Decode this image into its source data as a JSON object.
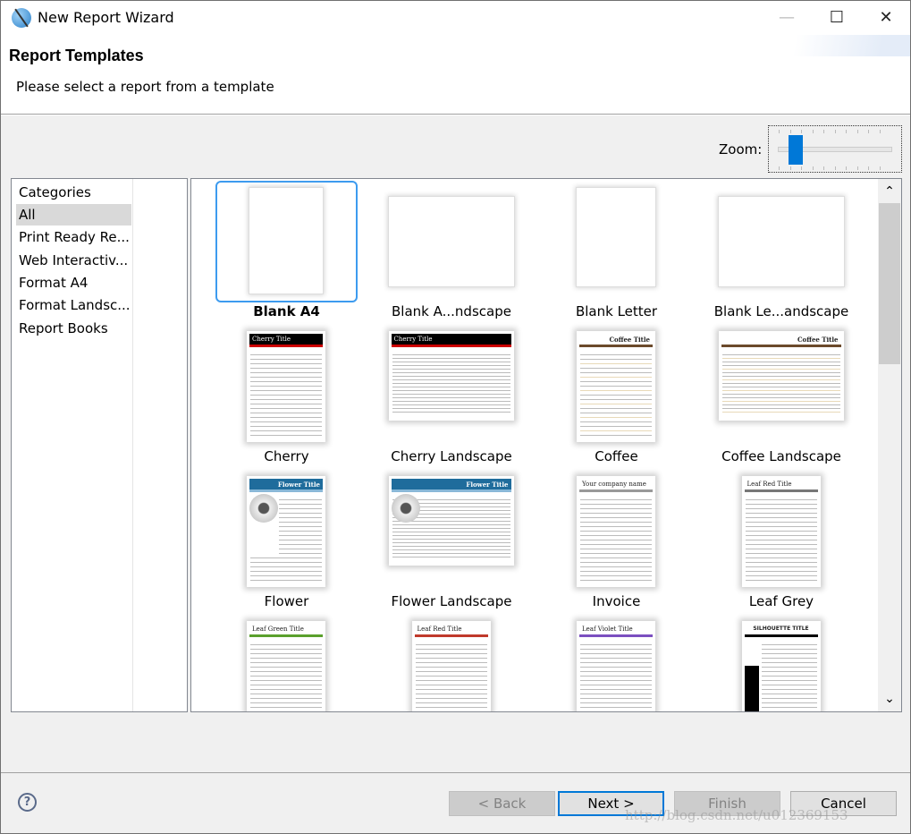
{
  "window": {
    "title": "New Report Wizard",
    "minimize": "—",
    "maximize": "☐",
    "close": "✕"
  },
  "header": {
    "title": "Report Templates",
    "subtitle": "Please select a report from a template"
  },
  "zoom": {
    "label": "Zoom:",
    "level_fraction": 0.12
  },
  "categories": {
    "header": "Categories",
    "items": [
      "All",
      "Print Ready Re...",
      "Web Interactiv...",
      "Format A4",
      "Format Landsc...",
      "Report Books"
    ],
    "selected": "All"
  },
  "templates": [
    {
      "label": "Blank A4",
      "style": "blank",
      "orient": "portrait",
      "selected": true
    },
    {
      "label": "Blank A...ndscape",
      "style": "blank",
      "orient": "landscape"
    },
    {
      "label": "Blank Letter",
      "style": "blank",
      "orient": "portrait"
    },
    {
      "label": "Blank Le...andscape",
      "style": "blank",
      "orient": "landscape"
    },
    {
      "label": "Cherry",
      "style": "cherry",
      "orient": "portrait",
      "thumb_title": "Cherry Title"
    },
    {
      "label": "Cherry Landscape",
      "style": "cherry",
      "orient": "landscape",
      "thumb_title": "Cherry Title"
    },
    {
      "label": "Coffee",
      "style": "coffee",
      "orient": "portrait",
      "thumb_title": "Coffee Title"
    },
    {
      "label": "Coffee Landscape",
      "style": "coffee",
      "orient": "landscape",
      "thumb_title": "Coffee Title"
    },
    {
      "label": "Flower",
      "style": "flower",
      "orient": "portrait",
      "thumb_title": "Flower Title"
    },
    {
      "label": "Flower Landscape",
      "style": "flower",
      "orient": "landscape",
      "thumb_title": "Flower Title"
    },
    {
      "label": "Invoice",
      "style": "invoice",
      "orient": "portrait",
      "thumb_title": "Your company name"
    },
    {
      "label": "Leaf Grey",
      "style": "leafgrey",
      "orient": "portrait",
      "thumb_title": "Leaf Red Title"
    },
    {
      "label": "",
      "style": "leafgreen",
      "orient": "portrait",
      "thumb_title": "Leaf Green Title"
    },
    {
      "label": "",
      "style": "leafred",
      "orient": "portrait",
      "thumb_title": "Leaf Red Title"
    },
    {
      "label": "",
      "style": "leafviolet",
      "orient": "portrait",
      "thumb_title": "Leaf Violet Title"
    },
    {
      "label": "",
      "style": "silhouette",
      "orient": "portrait",
      "thumb_title": "SILHOUETTE TITLE"
    }
  ],
  "colors": {
    "accent": "#0078d7",
    "selection_border": "#3d9bef",
    "cherry": "#000000",
    "cherry_accent": "#cc0000",
    "flower": "#1f6c9c",
    "coffee": "#6b4a2b",
    "leafgreen": "#5aa02c",
    "leafred": "#c0392b",
    "leafviolet": "#7b4fc0",
    "leafgrey": "#777777"
  },
  "buttons": {
    "help": "?",
    "back": "< Back",
    "next": "Next >",
    "finish": "Finish",
    "cancel": "Cancel"
  },
  "watermark": "http://blog.csdn.net/u012369153"
}
